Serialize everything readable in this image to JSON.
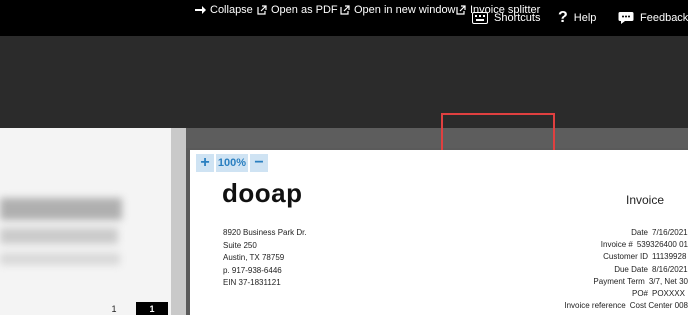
{
  "topbar": {
    "shortcuts_label": "Shortcuts",
    "help_label": "Help",
    "feedback_label": "Feedback"
  },
  "left_panel": {
    "page_number": "1",
    "page_indicator": "1"
  },
  "viewer_toolbar": {
    "collapse_label": "Collapse",
    "open_pdf_label": "Open as PDF",
    "open_window_label": "Open in new window",
    "splitter_label": "Invoice splitter",
    "zoom_in": "+",
    "zoom_level": "100%",
    "zoom_out": "−"
  },
  "invoice": {
    "logo": "dooap",
    "title": "Invoice",
    "address": {
      "line1": "8920 Business Park Dr.",
      "line2": "Suite 250",
      "line3": "Austin, TX 78759",
      "phone": "p. 917-938-6446",
      "ein": "EIN 37-1831121"
    },
    "details": [
      {
        "label": "Date",
        "value": "7/16/2021"
      },
      {
        "label": "Invoice #",
        "value": "539326400 01"
      },
      {
        "label": "Customer ID",
        "value": "11139928"
      },
      {
        "label": "Due Date",
        "value": "8/16/2021"
      },
      {
        "label": "Payment Term",
        "value": "3/7, Net 30"
      },
      {
        "label": "PO#",
        "value": "POXXXX"
      },
      {
        "label": "Invoice reference",
        "value": "Cost Center 008"
      }
    ]
  },
  "colors": {
    "topbar": "#000000",
    "toolbar": "#5d5d5d",
    "zoom_accent": "#2a7fc0",
    "highlight": "#e04040"
  }
}
